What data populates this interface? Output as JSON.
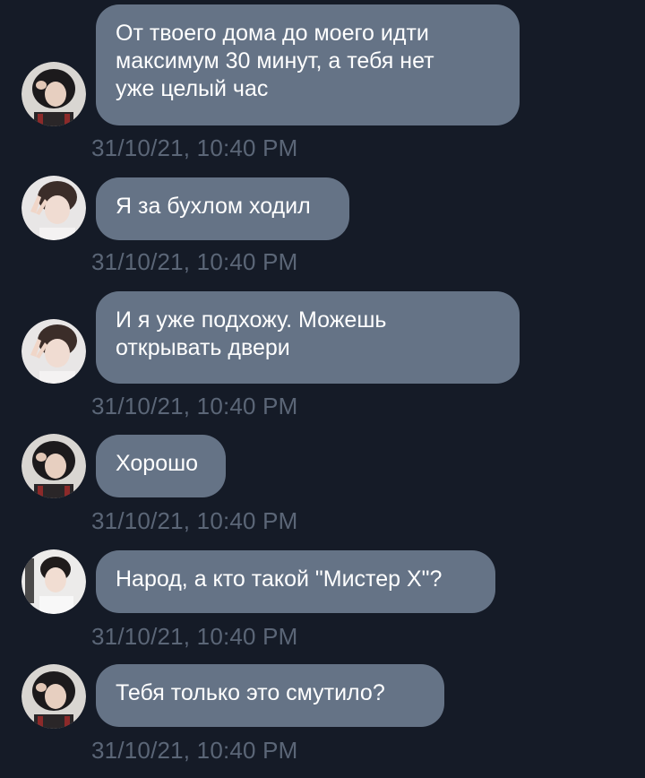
{
  "messages": [
    {
      "text": "От твоего дома до моего идти\nмаксимум 30 минут, а тебя нет\nуже целый час",
      "time": "31/10/21, 10:40 PM",
      "avatar": "avatar-dark-hair-gesture"
    },
    {
      "text": "Я за бухлом ходил",
      "time": "31/10/21, 10:40 PM",
      "avatar": "avatar-peace-sign"
    },
    {
      "text": "И я уже подхожу. Можешь\nоткрывать двери",
      "time": "31/10/21, 10:40 PM",
      "avatar": "avatar-peace-sign"
    },
    {
      "text": "Хорошо",
      "time": "31/10/21, 10:40 PM",
      "avatar": "avatar-dark-hair-gesture"
    },
    {
      "text": "Народ, а кто такой \"Мистер Х\"?",
      "time": "31/10/21, 10:40 PM",
      "avatar": "avatar-white-shirt"
    },
    {
      "text": "Тебя только это смутило?",
      "time": "31/10/21, 10:40 PM",
      "avatar": "avatar-dark-hair-gesture"
    }
  ],
  "colors": {
    "background": "#151b27",
    "bubble": "#657386",
    "bubble_text": "#ffffff",
    "timestamp": "#5b6677"
  }
}
